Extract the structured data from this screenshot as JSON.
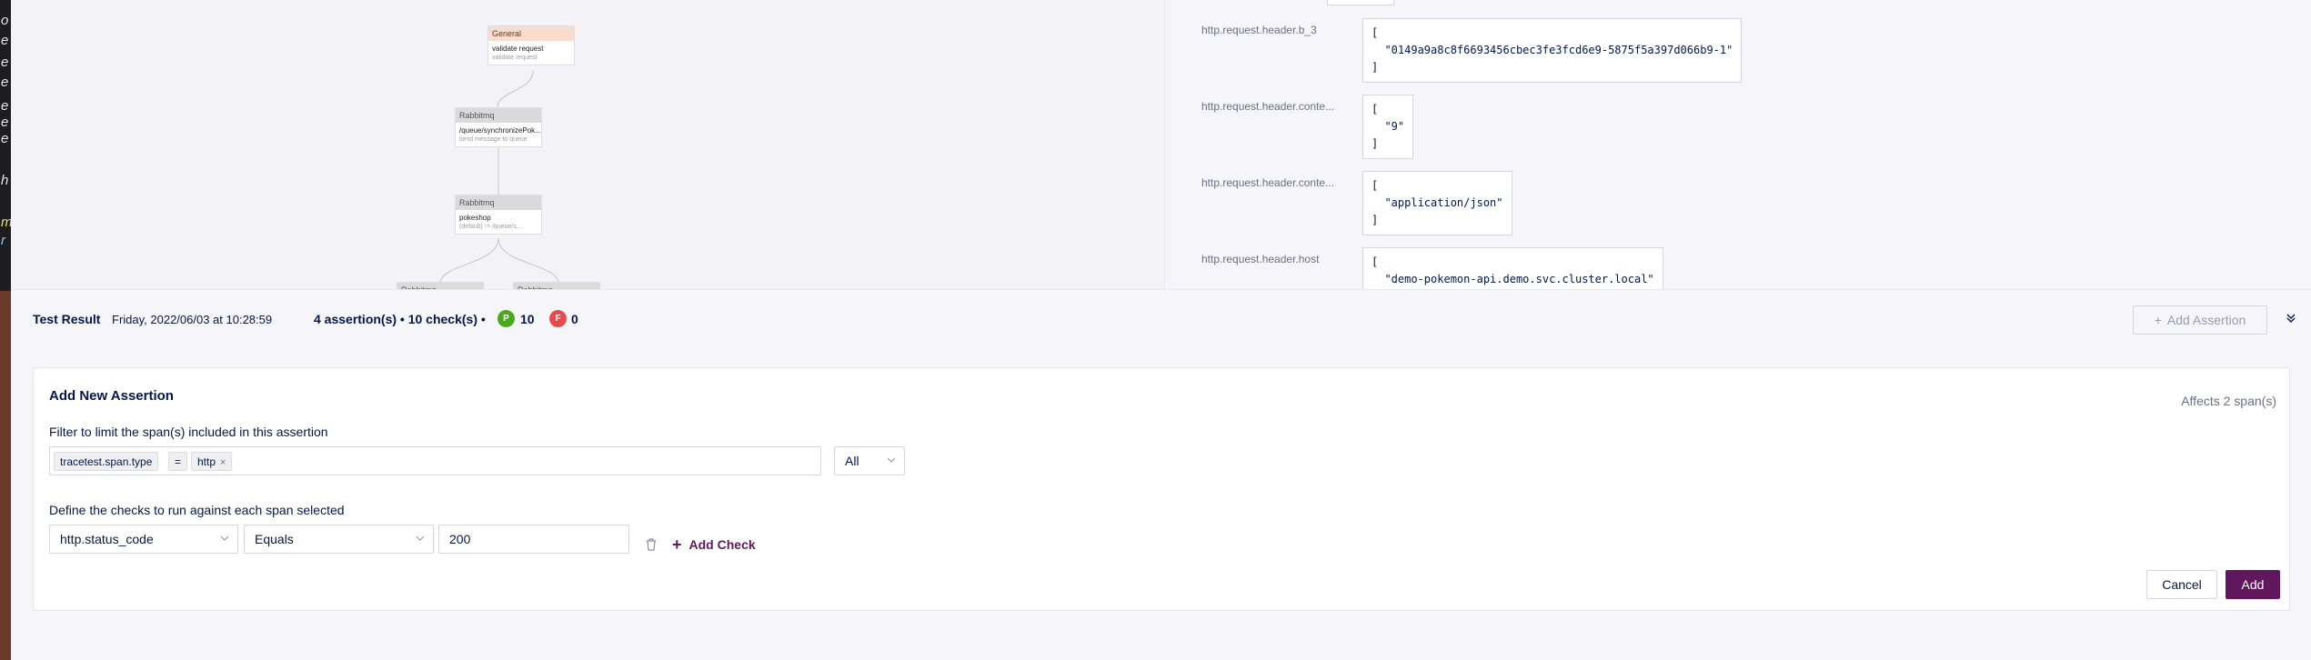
{
  "left_strip_chars": [
    "o",
    "e",
    "e",
    "e",
    "e",
    "e",
    "e",
    "h",
    "m",
    "r"
  ],
  "graph": {
    "nodes": [
      {
        "id": "general",
        "type": "General",
        "title": "validate request",
        "subtitle": "validate request"
      },
      {
        "id": "rabbit1",
        "type": "Rabbitmq",
        "title": "/queue/synchronizePok...",
        "subtitle": "send message to queue"
      },
      {
        "id": "rabbit2",
        "type": "Rabbitmq",
        "title": "pokeshop",
        "subtitle": "(default) -> /queue/s..."
      },
      {
        "id": "rabbit3",
        "type": "Rabbitmq",
        "title": "",
        "subtitle": ""
      },
      {
        "id": "rabbit4",
        "type": "Rabbitmq",
        "title": "",
        "subtitle": ""
      }
    ]
  },
  "attributes": [
    {
      "key": "http.request.header.b_3",
      "value": "[\n  \"0149a9a8c8f6693456cbec3fe3fcd6e9-5875f5a397d066b9-1\"\n]"
    },
    {
      "key": "http.request.header.conte...",
      "value": "[\n  \"9\"\n]"
    },
    {
      "key": "http.request.header.conte...",
      "value": "[\n  \"application/json\"\n]"
    },
    {
      "key": "http.request.header.host",
      "value": "[\n  \"demo-pokemon-api.demo.svc.cluster.local\""
    }
  ],
  "result_bar": {
    "title": "Test Result",
    "date": "Friday, 2022/06/03 at 10:28:59",
    "summary": "4 assertion(s) • 10 check(s) •",
    "pass_badge": "P",
    "pass_count": "10",
    "fail_badge": "F",
    "fail_count": "0",
    "add_assertion_label": "Add Assertion",
    "add_assertion_icon": "plus-icon",
    "collapse_icon": "double-chevron-down-icon"
  },
  "form": {
    "title": "Add New Assertion",
    "affects": "Affects 2 span(s)",
    "filter_label": "Filter to limit the span(s) included in this assertion",
    "filter_tags": [
      {
        "text": "tracetest.span.type",
        "removable": false
      },
      {
        "text": "=",
        "removable": false
      },
      {
        "text": "http",
        "removable": true
      }
    ],
    "remove_tag_glyph": "×",
    "scope_select": "All",
    "checks_label": "Define the checks to run against each span selected",
    "check": {
      "attribute": "http.status_code",
      "operator": "Equals",
      "value": "200"
    },
    "add_check_label": "Add Check",
    "cancel_label": "Cancel",
    "add_label": "Add"
  },
  "colors": {
    "primary": "#61175e",
    "pass": "#49aa19",
    "fail": "#e64c4c",
    "text": "#031849"
  }
}
